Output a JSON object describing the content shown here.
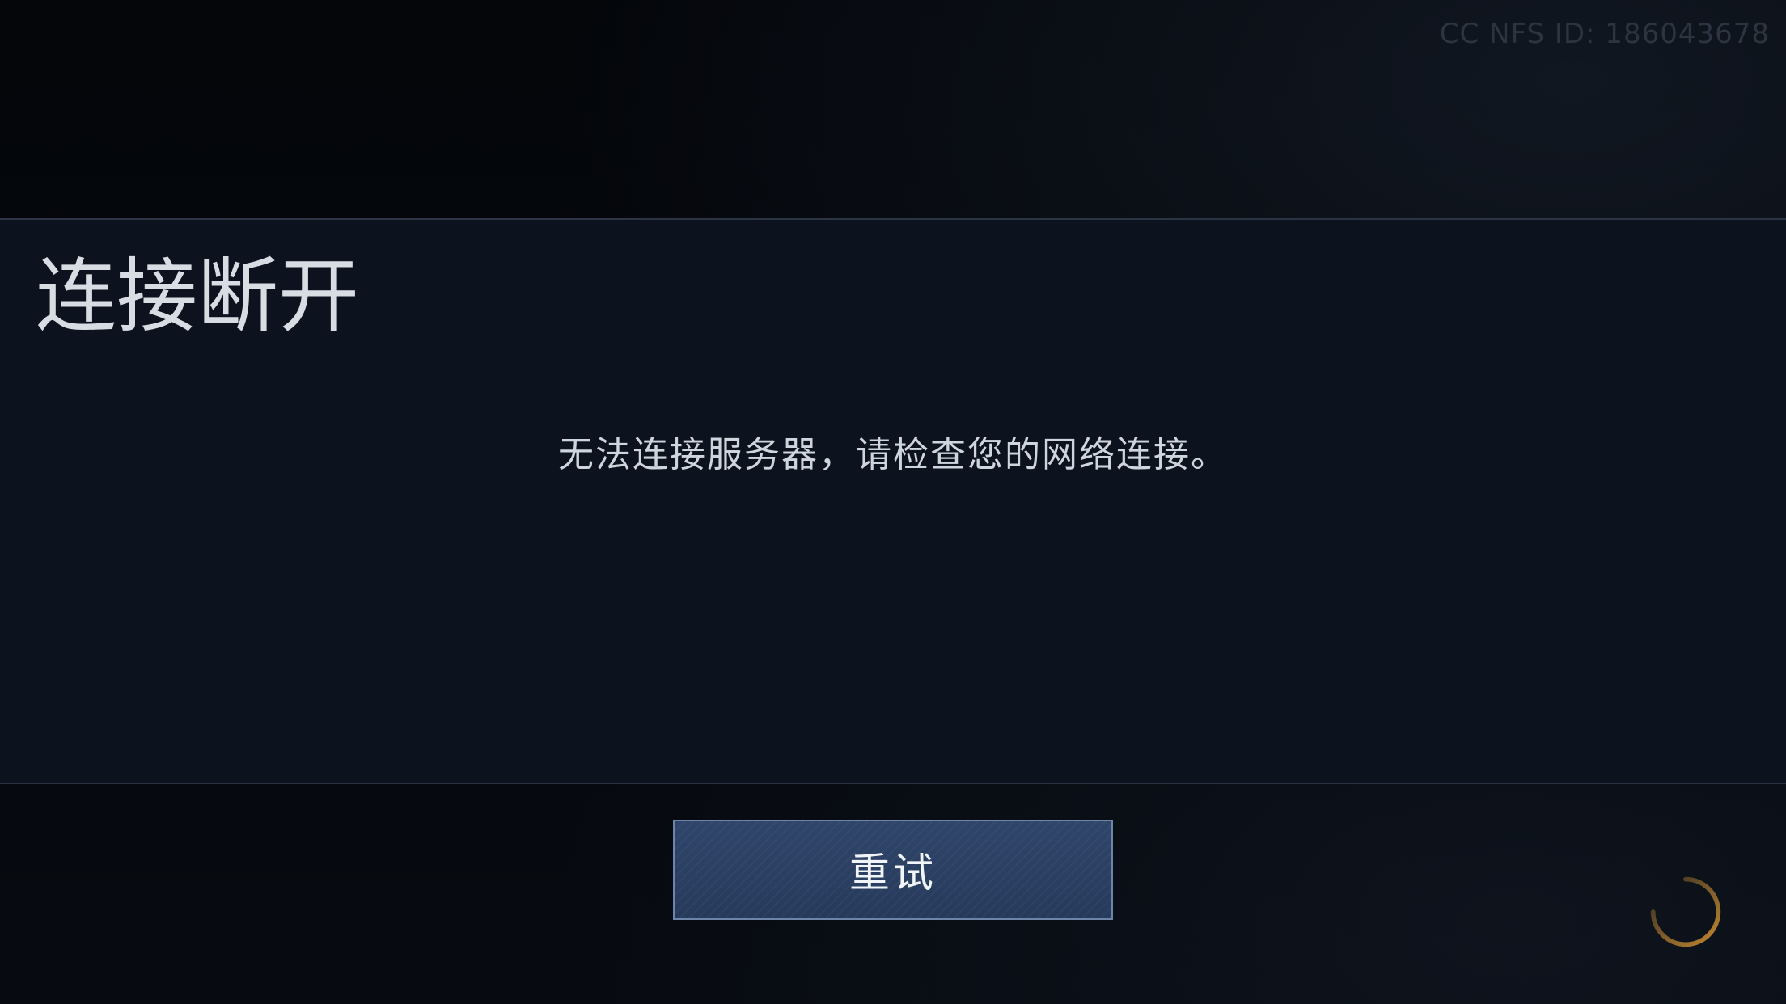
{
  "build_id": "CC NFS ID: 186043678",
  "dialog": {
    "title": "连接断开",
    "message": "无法连接服务器，请检查您的网络连接。",
    "retry_label": "重试"
  },
  "icons": {
    "spinner": "loading-spinner-icon"
  },
  "colors": {
    "panel_bg": "#0d131e",
    "button_bg": "#2f456a",
    "button_border": "#6d85a8",
    "spinner": "#c98a2e"
  }
}
